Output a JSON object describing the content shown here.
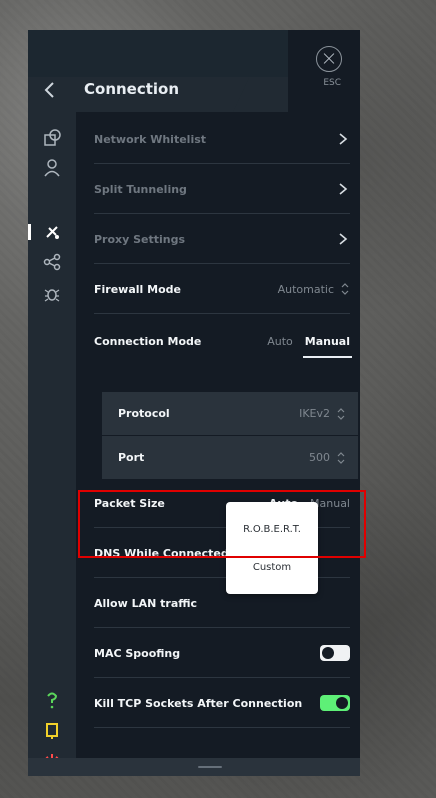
{
  "header": {
    "title": "Connection",
    "esc_label": "ESC"
  },
  "sidebar": {
    "icons": [
      "connections-icon",
      "account-icon",
      "connection-icon",
      "share-icon",
      "debug-icon"
    ],
    "bottom_icons": [
      "help-icon",
      "feedback-icon",
      "power-icon"
    ],
    "accent_colors": {
      "help": "#5bd65b",
      "feedback": "#f1d02a",
      "power": "#ff4b4b"
    }
  },
  "rows": {
    "network_whitelist": "Network Whitelist",
    "split_tunneling": "Split Tunneling",
    "proxy_settings": "Proxy Settings",
    "firewall_mode": {
      "label": "Firewall Mode",
      "value": "Automatic"
    },
    "connection_mode": {
      "label": "Connection Mode",
      "auto": "Auto",
      "manual": "Manual"
    },
    "protocol": {
      "label": "Protocol",
      "value": "IKEv2"
    },
    "port": {
      "label": "Port",
      "value": "500"
    },
    "packet_size": {
      "label": "Packet Size",
      "auto": "Auto",
      "manual": "Manual"
    },
    "dns": {
      "label": "DNS While Connected"
    },
    "allow_lan": {
      "label": "Allow LAN traffic"
    },
    "mac_spoofing": {
      "label": "MAC Spoofing",
      "state": "off"
    },
    "kill_tcp": {
      "label": "Kill TCP Sockets After Connection",
      "state": "on"
    }
  },
  "dns_popup": {
    "options": [
      "R.O.B.E.R.T.",
      "Custom"
    ]
  }
}
